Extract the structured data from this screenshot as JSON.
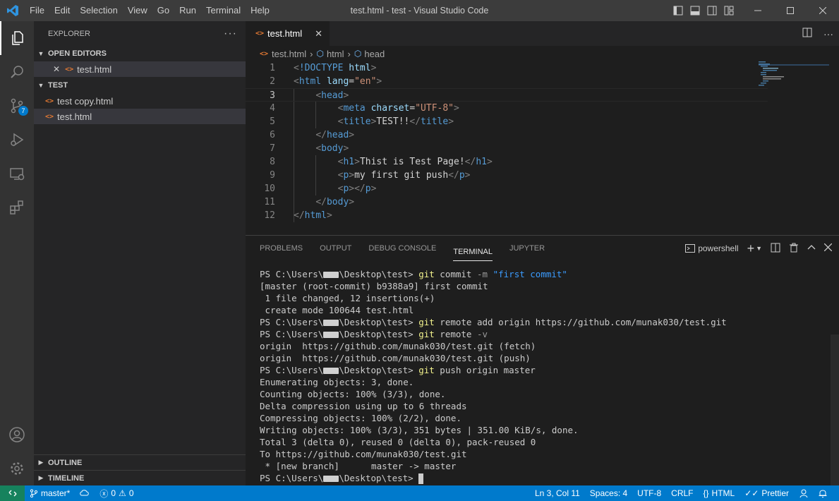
{
  "window": {
    "title": "test.html - test - Visual Studio Code",
    "menu": [
      "File",
      "Edit",
      "Selection",
      "View",
      "Go",
      "Run",
      "Terminal",
      "Help"
    ]
  },
  "activity": {
    "scm_badge": "7"
  },
  "sidebar": {
    "title": "EXPLORER",
    "more": "···",
    "open_editors_label": "OPEN EDITORS",
    "open_editors": [
      {
        "name": "test.html",
        "close": "✕"
      }
    ],
    "folder_label": "TEST",
    "files": [
      {
        "name": "test copy.html"
      },
      {
        "name": "test.html"
      }
    ],
    "outline_label": "OUTLINE",
    "timeline_label": "TIMELINE"
  },
  "editor": {
    "tab": {
      "name": "test.html",
      "close": "✕"
    },
    "breadcrumb": [
      "test.html",
      "html",
      "head"
    ],
    "line_numbers": [
      "1",
      "2",
      "3",
      "4",
      "5",
      "6",
      "7",
      "8",
      "9",
      "10",
      "11",
      "12"
    ]
  },
  "panel": {
    "tabs": [
      "PROBLEMS",
      "OUTPUT",
      "DEBUG CONSOLE",
      "TERMINAL",
      "JUPYTER"
    ],
    "active_tab": "TERMINAL",
    "shell": "powershell",
    "prompt_prefix": "PS C:\\Users\\",
    "prompt_suffix": "\\Desktop\\test> ",
    "lines": {
      "l1_cmd": "git",
      "l1_rest": " commit ",
      "l1_flag": "-m",
      "l1_str": " \"first commit\"",
      "l2": "[master (root-commit) b9388a9] first commit",
      "l3": " 1 file changed, 12 insertions(+)",
      "l4": " create mode 100644 test.html",
      "l5_cmd": "git",
      "l5_rest": " remote add origin https://github.com/munak030/test.git",
      "l6_cmd": "git",
      "l6_rest": " remote ",
      "l6_flag": "-v",
      "l7": "origin  https://github.com/munak030/test.git (fetch)",
      "l8": "origin  https://github.com/munak030/test.git (push)",
      "l9_cmd": "git",
      "l9_rest": " push origin master",
      "l10": "Enumerating objects: 3, done.",
      "l11": "Counting objects: 100% (3/3), done.",
      "l12": "Delta compression using up to 6 threads",
      "l13": "Compressing objects: 100% (2/2), done.",
      "l14": "Writing objects: 100% (3/3), 351 bytes | 351.00 KiB/s, done.",
      "l15": "Total 3 (delta 0), reused 0 (delta 0), pack-reused 0",
      "l16": "To https://github.com/munak030/test.git",
      "l17": " * [new branch]      master -> master"
    }
  },
  "status": {
    "branch": "master*",
    "errors": "0",
    "warnings": "0",
    "position": "Ln 3, Col 11",
    "spaces": "Spaces: 4",
    "encoding": "UTF-8",
    "eol": "CRLF",
    "language": "HTML",
    "prettier": "Prettier"
  },
  "colors": {
    "accent": "#007acc",
    "remote": "#16825d",
    "html_icon": "#e37933"
  }
}
